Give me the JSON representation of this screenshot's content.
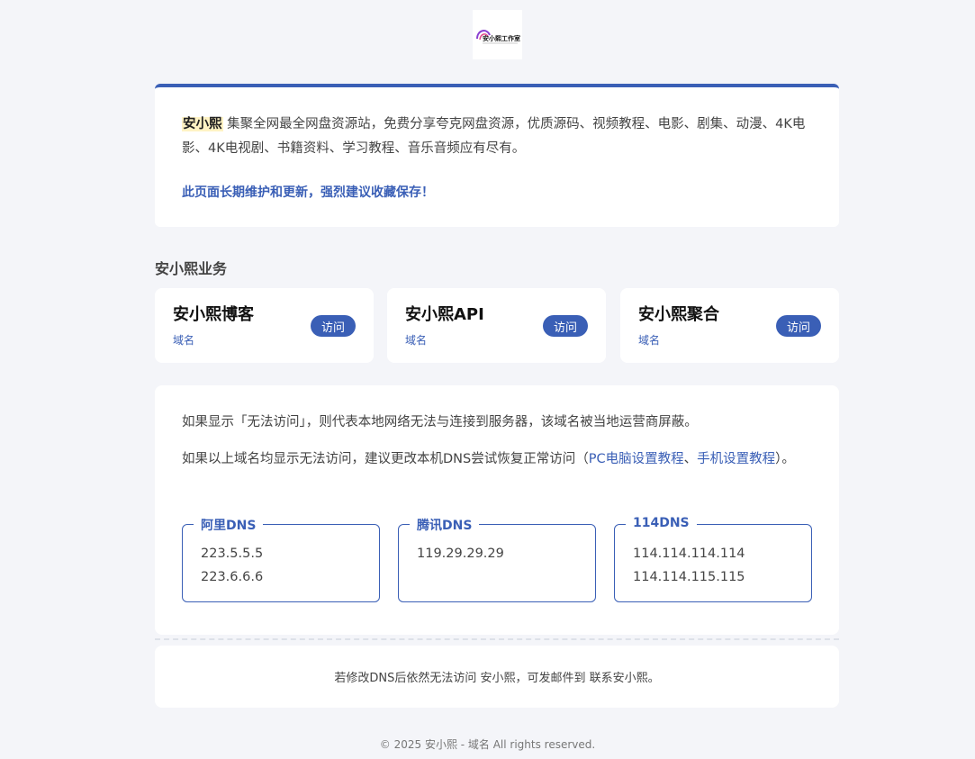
{
  "logo": {
    "text": "安小熙工作室",
    "icon": "studio-logo"
  },
  "intro": {
    "brand": "安小熙",
    "description": "集聚全网最全网盘资源站，免费分享夸克网盘资源，优质源码、视频教程、电影、剧集、动漫、4K电影、4K电视剧、书籍资料、学习教程、音乐音频应有尽有。",
    "notice": "此页面长期维护和更新，强烈建议收藏保存！"
  },
  "services": {
    "title": "安小熙业务",
    "items": [
      {
        "name": "安小熙博客",
        "domain": "域名",
        "button": "访问"
      },
      {
        "name": "安小熙API",
        "domain": "域名",
        "button": "访问"
      },
      {
        "name": "安小熙聚合",
        "domain": "域名",
        "button": "访问"
      }
    ]
  },
  "dns_help": {
    "line1": "如果显示「无法访问」，则代表本地网络无法与连接到服务器，该域名被当地运营商屏蔽。",
    "line2_prefix": "如果以上域名均显示无法访问，建议更改本机DNS尝试恢复正常访问（",
    "pc_link": "PC电脑设置教程",
    "separator": "、",
    "mobile_link": "手机设置教程",
    "line2_suffix": "）。",
    "providers": [
      {
        "name": "阿里DNS",
        "ips": [
          "223.5.5.5",
          "223.6.6.6"
        ]
      },
      {
        "name": "腾讯DNS",
        "ips": [
          "119.29.29.29"
        ]
      },
      {
        "name": "114DNS",
        "ips": [
          "114.114.114.114",
          "114.114.115.115"
        ]
      }
    ]
  },
  "contact": {
    "text": "若修改DNS后依然无法访问 安小熙，可发邮件到 联系安小熙。"
  },
  "footer": {
    "text": "© 2025 安小熙 - 域名 All rights reserved."
  },
  "colors": {
    "accent": "#3a5fb6",
    "background": "#f4f5f9",
    "highlight": "#fff3c4"
  }
}
